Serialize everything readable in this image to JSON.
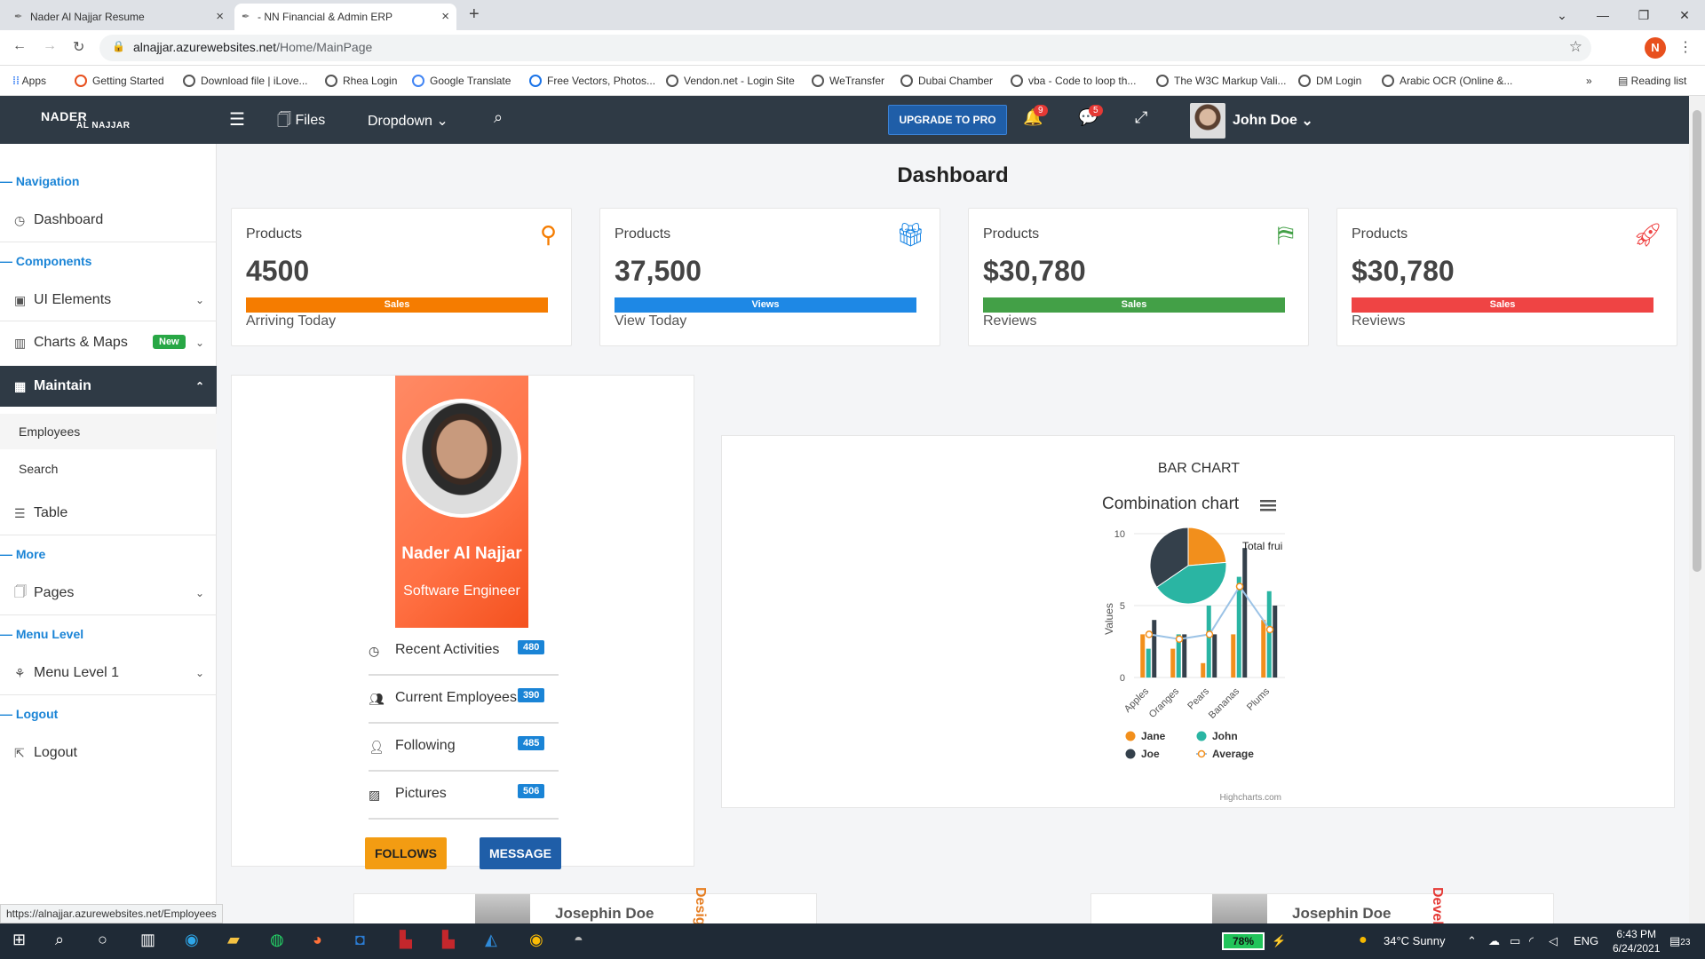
{
  "browser": {
    "tabs": [
      {
        "title": "Nader Al Najjar Resume"
      },
      {
        "title": "- NN Financial & Admin ERP"
      }
    ],
    "url_domain": "alnajjar.azurewebsites.net",
    "url_path": "/Home/MainPage",
    "profile_initial": "N",
    "bookmarks": [
      "Apps",
      "Getting Started",
      "Download file | iLove...",
      "Rhea Login",
      "Google Translate",
      "Free Vectors, Photos...",
      "Vendon.net - Login Site",
      "WeTransfer",
      "Dubai Chamber",
      "vba - Code to loop th...",
      "The W3C Markup Vali...",
      "DM Login",
      "Arabic OCR (Online &...",
      "»",
      "Reading list"
    ],
    "status_url": "https://alnajjar.azurewebsites.net/Employees"
  },
  "header": {
    "logo_top": "NADER",
    "logo_bottom": "AL NAJJAR",
    "files": "Files",
    "dropdown": "Dropdown",
    "upgrade": "UPGRADE TO PRO",
    "notif_count": "9",
    "msg_count": "5",
    "user_name": "John Doe"
  },
  "sidebar": {
    "sec_navigation": "Navigation",
    "dashboard": "Dashboard",
    "sec_components": "Components",
    "ui_elements": "UI Elements",
    "charts_maps": "Charts & Maps",
    "new_badge": "New",
    "maintain": "Maintain",
    "employees": "Employees",
    "search": "Search",
    "table": "Table",
    "sec_more": "More",
    "pages": "Pages",
    "sec_menu_level": "Menu Level",
    "menu_level_1": "Menu Level 1",
    "sec_logout": "Logout",
    "logout": "Logout"
  },
  "page": {
    "title": "Dashboard"
  },
  "cards": [
    {
      "label": "Products",
      "value": "4500",
      "bar": "Sales",
      "foot": "Arriving Today",
      "color": "#f57c00",
      "icon": "broadcast-icon"
    },
    {
      "label": "Products",
      "value": "37,500",
      "bar": "Views",
      "foot": "View Today",
      "color": "#1e88e5",
      "icon": "gift-icon"
    },
    {
      "label": "Products",
      "value": "$30,780",
      "bar": "Sales",
      "foot": "Reviews",
      "color": "#43a047",
      "icon": "signpost-icon"
    },
    {
      "label": "Products",
      "value": "$30,780",
      "bar": "Sales",
      "foot": "Reviews",
      "color": "#ef4444",
      "icon": "rocket-icon"
    }
  ],
  "profile": {
    "name": "Nader Al Najjar",
    "role": "Software Engineer",
    "stats": [
      {
        "label": "Recent Activities",
        "count": "480",
        "icon": "clock-icon"
      },
      {
        "label": "Current Employees",
        "count": "390",
        "icon": "users-icon"
      },
      {
        "label": "Following",
        "count": "485",
        "icon": "user-icon"
      },
      {
        "label": "Pictures",
        "count": "506",
        "icon": "picture-icon"
      }
    ],
    "follows": "FOLLOWS",
    "message": "MESSAGE"
  },
  "chart_card": {
    "heading": "BAR CHART",
    "credit": "Highcharts.com"
  },
  "chart_data": {
    "type": "bar",
    "title": "Combination chart",
    "ylabel": "Values",
    "ylim": [
      0,
      10
    ],
    "yticks": [
      0,
      5,
      10
    ],
    "categories": [
      "Apples",
      "Oranges",
      "Pears",
      "Bananas",
      "Plums"
    ],
    "series": [
      {
        "name": "Jane",
        "type": "bar",
        "color": "#f28f1c",
        "values": [
          3,
          2,
          1,
          3,
          4
        ]
      },
      {
        "name": "John",
        "type": "bar",
        "color": "#2ab5a3",
        "values": [
          2,
          3,
          5,
          7,
          6
        ]
      },
      {
        "name": "Joe",
        "type": "bar",
        "color": "#34404b",
        "values": [
          4,
          3,
          3,
          9,
          5
        ]
      },
      {
        "name": "Average",
        "type": "line",
        "color": "#9cc3e6",
        "values": [
          3,
          2.67,
          3,
          6.33,
          3.33
        ]
      }
    ],
    "pie": {
      "name": "Total fruit consumption",
      "visible_label": "Total frui",
      "slices": [
        {
          "name": "Jane",
          "value": 13,
          "color": "#f28f1c"
        },
        {
          "name": "John",
          "value": 23,
          "color": "#2ab5a3"
        },
        {
          "name": "Joe",
          "value": 19,
          "color": "#34404b"
        }
      ]
    }
  },
  "teasers": [
    {
      "name": "Josephin Doe",
      "role": "Desig",
      "color": "#e67e22"
    },
    {
      "name": "Josephin Doe",
      "role": "Devel",
      "color": "#e53935"
    }
  ],
  "taskbar": {
    "battery": "78%",
    "weather": "34°C  Sunny",
    "lang": "ENG",
    "time": "6:43 PM",
    "date": "6/24/2021",
    "notif": "23"
  }
}
